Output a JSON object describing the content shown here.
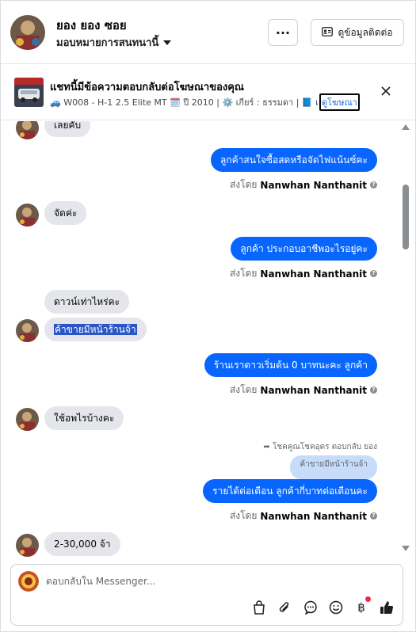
{
  "header": {
    "name": "ยอง ยอง ซอย",
    "assign_label": "มอบหมายการสนทนานี้",
    "more_label": "···",
    "contact_label": "ดูข้อมูลติดต่อ"
  },
  "ad": {
    "title": "แชทนี้มีข้อความตอบกลับต่อโฆษณาของคุณ",
    "desc": "🚙 W008 - H-1 2.5 Elite MT 🗓️ ปี 2010 | ⚙️ เกียร์ : ธรรมดา | 📘 เครื่อง...",
    "link_label": "ดูโฆษณา"
  },
  "messages": {
    "m1": "เลยคับ",
    "m2": "ลูกค้าสนใจซื้อสดหรือจัดไฟแน้นซ์คะ",
    "m3": "จัดค่ะ",
    "m4": "ลูกค้า ประกอบอาชีพอะไรอยู่คะ",
    "m5": "ดาวน์เท่าไหร่คะ",
    "m6": "ค้าขายมีหน้าร้านจ้า",
    "m7": "ร้านเราดาวเริ่มต้น 0 บาทนะคะ  ลูกค้า",
    "m8": "ใช้อพไรบ้างคะ",
    "reply_note": "โชคคูณโชคอุดร ตอบกลับ ยอง",
    "quoted": "ค้าขายมีหน้าร้านจ้า",
    "m9": "รายได้ต่อเดือน ลูกค้ากี่บาทต่อเดือนคะ",
    "m10": "2-30,000 จ้า",
    "sent_by_prefix": "ส่งโดย",
    "sent_by_name": "Nanwhan Nanthanit"
  },
  "composer": {
    "placeholder": "ตอบกลับใน Messenger..."
  },
  "icons": {
    "more": "more-horizontal-icon",
    "contact": "contact-card-icon",
    "close": "close-icon",
    "shopping": "shopping-bag-icon",
    "attach": "paperclip-icon",
    "saved_reply": "speech-bubble-icon",
    "emoji": "smiley-icon",
    "payment": "baht-icon",
    "like": "thumbs-up-icon"
  },
  "colors": {
    "outgoing": "#0866ff",
    "incoming": "#e4e6eb",
    "selection": "#2a56c6",
    "notification": "#f02849"
  }
}
